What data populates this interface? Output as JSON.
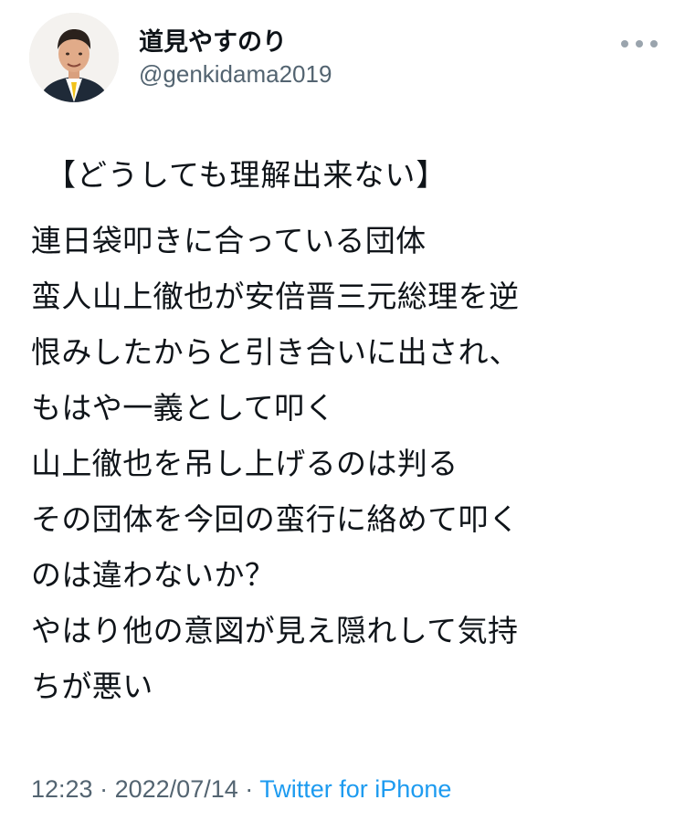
{
  "author": {
    "display_name": "道見やすのり",
    "handle": "@genkidama2019",
    "avatar_icon": "profile-photo"
  },
  "menu": {
    "icon": "more-horizontal-icon"
  },
  "tweet": {
    "title": "【どうしても理解出来ない】",
    "lines": [
      "連日袋叩きに合っている団体",
      "蛮人山上徹也が安倍晋三元総理を逆",
      "恨みしたからと引き合いに出され、",
      "もはや一義として叩く",
      "山上徹也を吊し上げるのは判る",
      "その団体を今回の蛮行に絡めて叩く",
      "のは違わないか？",
      "やはり他の意図が見え隠れして気持",
      "ちが悪い"
    ]
  },
  "meta": {
    "time": "12:23",
    "separator": "·",
    "date": "2022/07/14",
    "source": "Twitter for iPhone"
  },
  "colors": {
    "text": "#0f1419",
    "secondary": "#536471",
    "link": "#1d9bf0",
    "background": "#ffffff"
  }
}
